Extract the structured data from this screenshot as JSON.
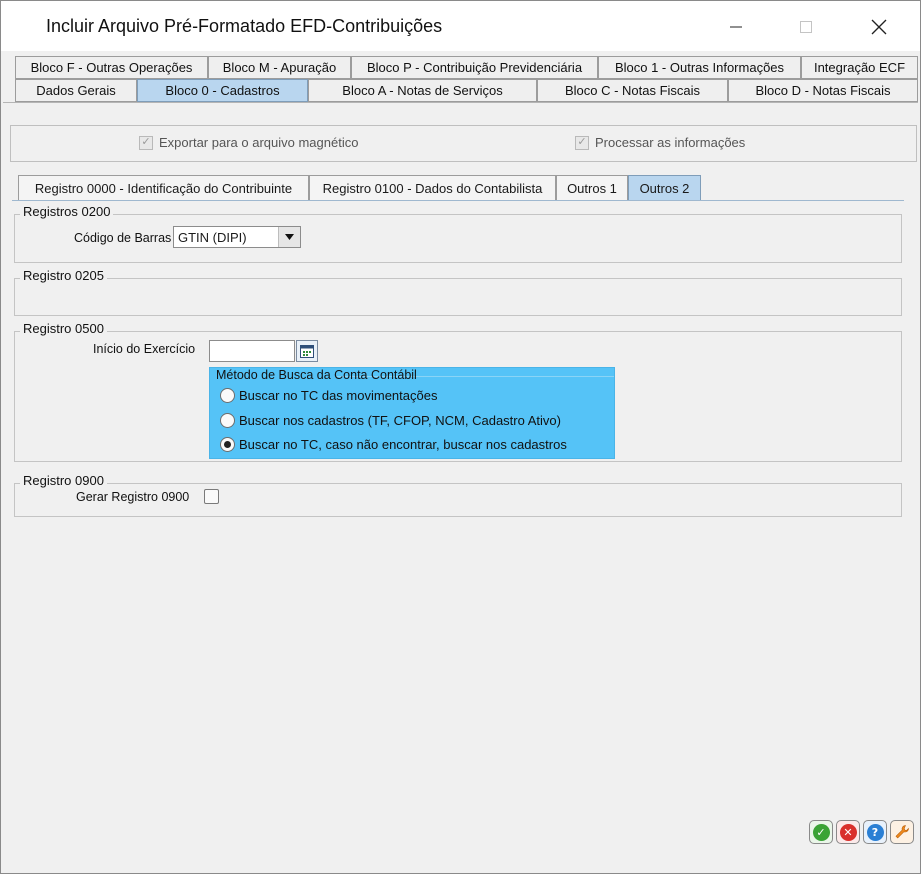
{
  "window": {
    "title": "Incluir Arquivo Pré-Formatado EFD-Contribuições"
  },
  "main_tabs": {
    "row1": [
      {
        "label": "Bloco F - Outras Operações"
      },
      {
        "label": "Bloco M - Apuração"
      },
      {
        "label": "Bloco P - Contribuição Previdenciária"
      },
      {
        "label": "Bloco 1 - Outras Informações"
      },
      {
        "label": "Integração ECF"
      }
    ],
    "row2": [
      {
        "label": "Dados Gerais"
      },
      {
        "label": "Bloco 0 - Cadastros",
        "active": true
      },
      {
        "label": "Bloco A - Notas de Serviços"
      },
      {
        "label": "Bloco C - Notas Fiscais"
      },
      {
        "label": "Bloco D - Notas Fiscais"
      }
    ]
  },
  "export": {
    "exportar_label": "Exportar para o arquivo magnético",
    "exportar_checked": true,
    "processar_label": "Processar as informações",
    "processar_checked": true
  },
  "sub_tabs": [
    {
      "label": "Registro 0000 - Identificação do Contribuinte"
    },
    {
      "label": "Registro 0100 - Dados do Contabilista"
    },
    {
      "label": "Outros 1"
    },
    {
      "label": "Outros 2",
      "active": true
    }
  ],
  "reg0200": {
    "title": "Registros 0200",
    "codigo_label": "Código de Barras",
    "codigo_value": "GTIN (DIPI)"
  },
  "reg0205": {
    "title": "Registro 0205"
  },
  "reg0500": {
    "title": "Registro 0500",
    "inicio_label": "Início do Exercício",
    "inicio_value": "",
    "metodo": {
      "title": "Método de Busca da Conta Contábil",
      "options": [
        {
          "label": "Buscar no TC das movimentações",
          "selected": false
        },
        {
          "label": "Buscar nos cadastros (TF, CFOP, NCM, Cadastro Ativo)",
          "selected": false
        },
        {
          "label": "Buscar no TC, caso não encontrar, buscar nos cadastros",
          "selected": true
        }
      ]
    }
  },
  "reg0900": {
    "title": "Registro 0900",
    "gerar_label": "Gerar Registro 0900",
    "gerar_checked": false
  },
  "actions": [
    {
      "name": "confirm-button",
      "icon": "check-icon",
      "color": "#3aa335"
    },
    {
      "name": "cancel-button",
      "icon": "x-icon",
      "color": "#d9302c"
    },
    {
      "name": "help-button",
      "icon": "question-icon",
      "color": "#2a7fd4"
    },
    {
      "name": "tools-button",
      "icon": "wrench-icon",
      "color": "#f08a1c"
    }
  ]
}
